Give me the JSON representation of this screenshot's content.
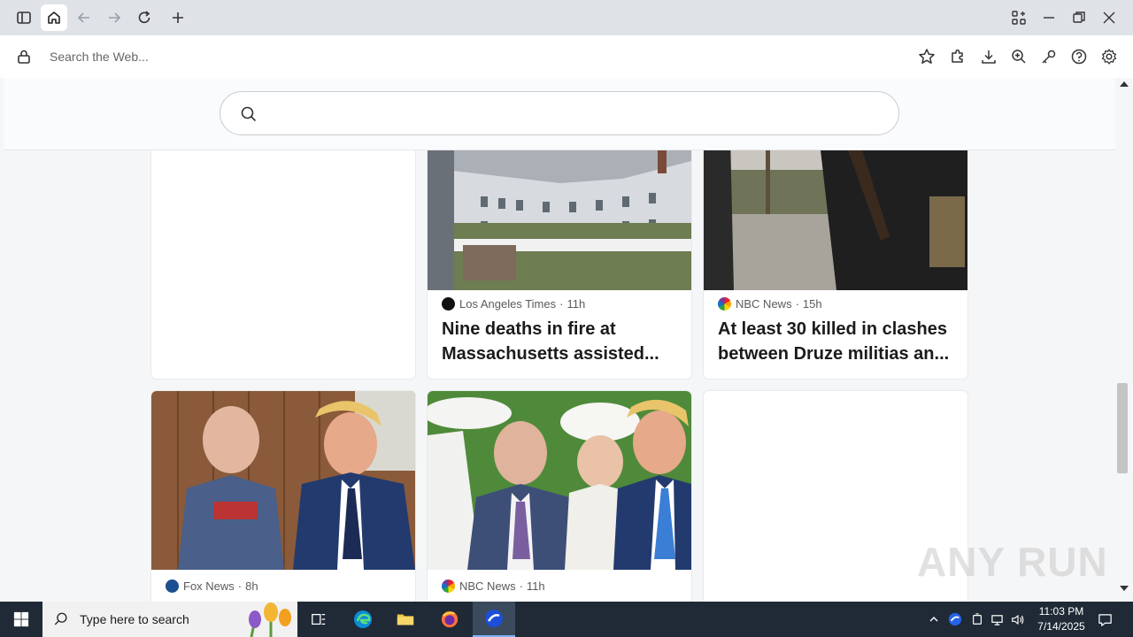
{
  "addressbar": {
    "placeholder": "Search the Web..."
  },
  "search": {
    "placeholder": ""
  },
  "cards": [
    {
      "source": "Los Angeles Times",
      "age": "11h",
      "headline": "Nine deaths in fire at Massachusetts assisted..."
    },
    {
      "source": "NBC News",
      "age": "15h",
      "headline": "At least 30 killed in clashes between Druze militias an..."
    },
    {
      "source": "Fox News",
      "age": "8h"
    },
    {
      "source": "NBC News",
      "age": "11h"
    }
  ],
  "taskbar": {
    "search_placeholder": "Type here to search",
    "time": "11:03 PM",
    "date": "7/14/2025"
  },
  "watermark": "ANY RUN",
  "colors": {
    "titlebar": "#dfe3e8",
    "taskbar": "#1f2a36",
    "accent": "#0078d4"
  }
}
